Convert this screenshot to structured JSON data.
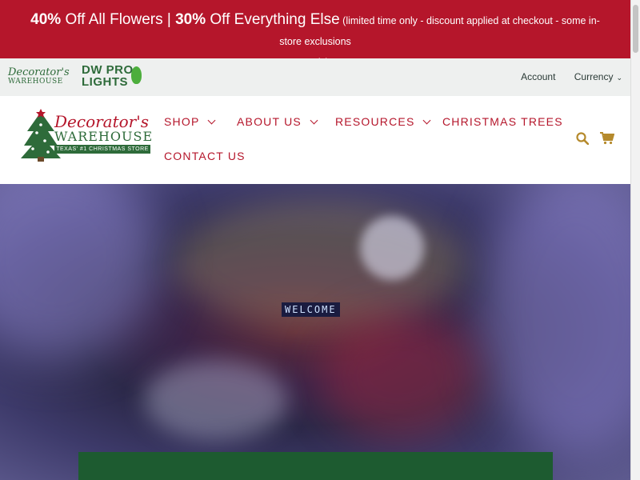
{
  "promo": {
    "pct1": "40%",
    "text1": " Off All Flowers | ",
    "pct2": "30%",
    "text2": " Off Everything Else",
    "note_part1": " (limited time only - discount applied at checkout - some in-store exclusions",
    "note_part2": "apply)"
  },
  "utility": {
    "logo_small_line1": "Decorator's",
    "logo_small_line2": "WAREHOUSE",
    "pro_line1": "DW PRO",
    "pro_line2": "LIGHTS",
    "account": "Account",
    "currency": "Currency"
  },
  "logo": {
    "line1": "Decorator's",
    "line2": "WAREHOUSE",
    "tagline": "TEXAS' #1 CHRISTMAS STORE"
  },
  "nav": {
    "shop": "SHOP",
    "about": "ABOUT US",
    "resources": "RESOURCES",
    "trees": "CHRISTMAS TREES",
    "contact": "CONTACT US"
  },
  "hero": {
    "sign": "WELCOME"
  },
  "colors": {
    "brand_red": "#b5162b",
    "brand_green": "#2e6b3a",
    "icon_gold": "#b58a2c"
  },
  "icons": [
    "search-icon",
    "cart-icon"
  ]
}
